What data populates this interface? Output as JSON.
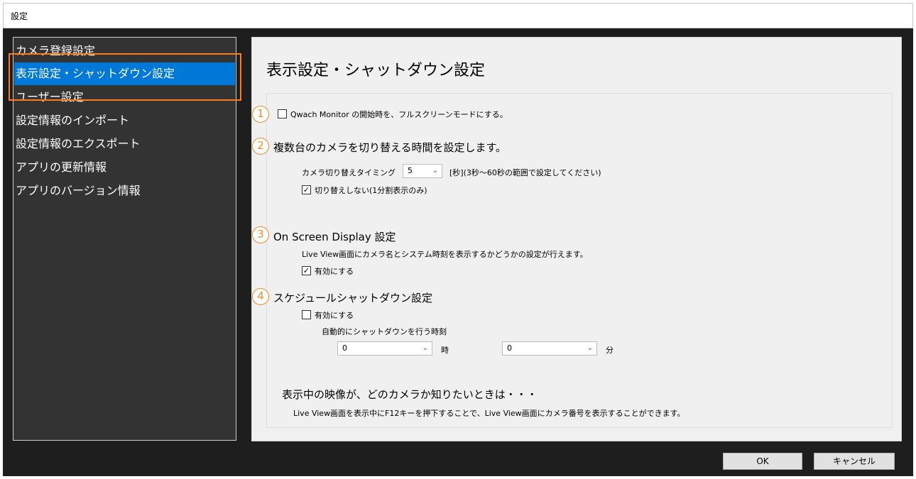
{
  "window": {
    "title": "設定"
  },
  "sidebar": {
    "items": [
      {
        "label": "カメラ登録設定"
      },
      {
        "label": "表示設定・シャットダウン設定"
      },
      {
        "label": "ユーザー設定"
      },
      {
        "label": "設定情報のインポート"
      },
      {
        "label": "設定情報のエクスポート"
      },
      {
        "label": "アプリの更新情報"
      },
      {
        "label": "アプリのバージョン情報"
      }
    ],
    "selected_index": 1
  },
  "main": {
    "title": "表示設定・シャットダウン設定",
    "markers": [
      "1",
      "2",
      "3",
      "4"
    ],
    "section1": {
      "checkbox_label": "Qwach Monitor の開始時を、フルスクリーンモードにする。",
      "checked": false
    },
    "section2": {
      "heading": "複数台のカメラを切り替える時間を設定します。",
      "timing_label": "カメラ切り替えタイミング",
      "timing_value": "5",
      "timing_note": "[秒](3秒～60秒の範囲で設定してください)",
      "no_switch_label": "切り替えしない(1分割表示のみ)",
      "no_switch_checked": true
    },
    "section3": {
      "heading": "On Screen Display 設定",
      "description": "Live View画面にカメラ名とシステム時刻を表示するかどうかの設定が行えます。",
      "enable_label": "有効にする",
      "enable_checked": true
    },
    "section4": {
      "heading": "スケジュールシャットダウン設定",
      "enable_label": "有効にする",
      "enable_checked": false,
      "time_label": "自動的にシャットダウンを行う時刻",
      "hour_value": "0",
      "hour_unit": "時",
      "minute_value": "0",
      "minute_unit": "分"
    },
    "tip": {
      "heading": "表示中の映像が、どのカメラか知りたいときは・・・",
      "text": "Live View画面を表示中にF12キーを押下することで、Live View画面にカメラ番号を表示することができます。"
    }
  },
  "footer": {
    "ok_label": "OK",
    "cancel_label": "キャンセル"
  },
  "icons": {
    "checked": "✓",
    "dropdown": "⌄"
  },
  "colors": {
    "accent": "#0078d7",
    "highlight": "#ff7a1a",
    "marker": "#f28c28"
  }
}
